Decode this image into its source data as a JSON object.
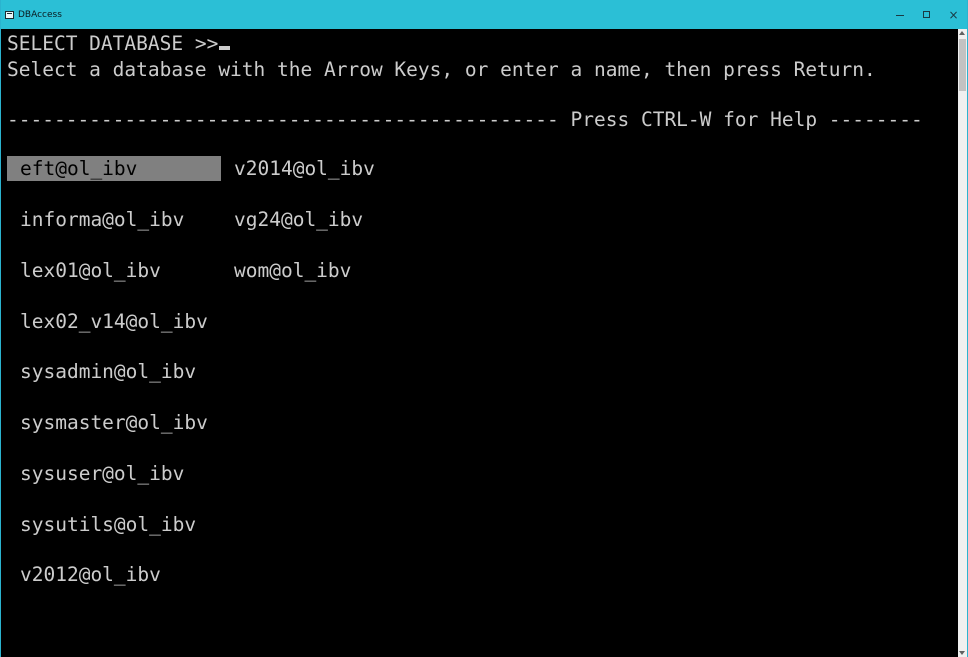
{
  "window": {
    "title": "DBAccess",
    "icon": "console-app-icon",
    "controls": {
      "minimize": "–",
      "maximize": "□",
      "close": "×"
    }
  },
  "console": {
    "prompt": "SELECT DATABASE >>",
    "instruction": "Select a database with the Arrow Keys, or enter a name, then press Return.",
    "divider": "----------------------------------------------- Press CTRL-W for Help --------",
    "databases_col1": [
      "eft@ol_ibv",
      "informa@ol_ibv",
      "lex01@ol_ibv",
      "lex02_v14@ol_ibv",
      "sysadmin@ol_ibv",
      "sysmaster@ol_ibv",
      "sysuser@ol_ibv",
      "sysutils@ol_ibv",
      "v2012@ol_ibv"
    ],
    "databases_col2": [
      "v2014@ol_ibv",
      "vg24@ol_ibv",
      "wom@ol_ibv"
    ],
    "selected_database": "eft@ol_ibv"
  },
  "colors": {
    "titlebar": "#2bbfd6",
    "console_bg": "#000000",
    "console_fg": "#cccccc",
    "selection_bg": "#808080"
  }
}
